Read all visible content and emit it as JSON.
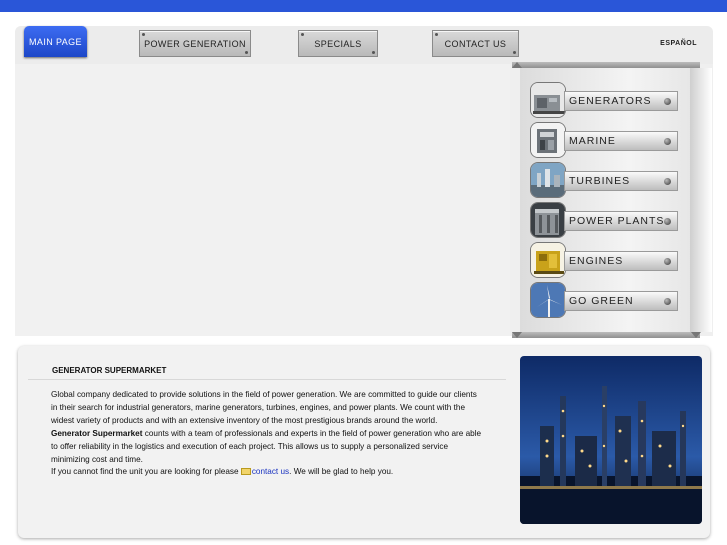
{
  "nav": {
    "items": [
      {
        "label": "MAIN PAGE"
      },
      {
        "label": "POWER GENERATION"
      },
      {
        "label": "SPECIALS"
      },
      {
        "label": "CONTACT US"
      }
    ],
    "language": "ESPAÑOL"
  },
  "side_menu": {
    "items": [
      {
        "label": "GENERATORS",
        "icon": "generator-thumbnail"
      },
      {
        "label": "MARINE",
        "icon": "marine-engine-thumbnail"
      },
      {
        "label": "TURBINES",
        "icon": "turbine-thumbnail"
      },
      {
        "label": "POWER PLANTS",
        "icon": "power-plant-thumbnail"
      },
      {
        "label": "ENGINES",
        "icon": "engine-thumbnail"
      },
      {
        "label": "GO GREEN",
        "icon": "wind-turbine-thumbnail"
      }
    ]
  },
  "info": {
    "title": "GENERATOR SUPERMARKET",
    "para1": "Global company dedicated to provide solutions in the field of power generation. We are committed to guide our clients in their search for industrial generators, marine generators, turbines, engines, and power plants. We count with the widest variety of products and with an extensive inventory of the most prestigious brands around the world.",
    "para2_bold": "Generator Supermarket",
    "para2_rest": " counts with a team of professionals and experts in the field of power generation who are able to offer reliability in the logistics and execution of each project. This allows us to supply a personalized service minimizing cost and time.",
    "para3_pre": "If you cannot find the unit you are looking for please ",
    "para3_link": "contact us",
    "para3_post": ". We will be glad to help you."
  },
  "colors": {
    "brand_blue": "#2a56d8",
    "link_blue": "#1a33c0"
  }
}
